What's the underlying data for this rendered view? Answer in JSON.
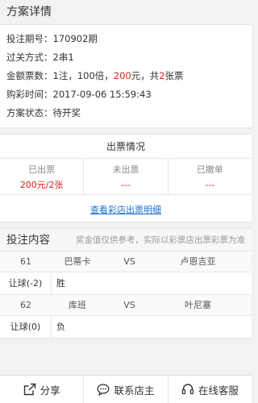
{
  "scheme": {
    "title": "方案详情",
    "rows": {
      "issue": "投注期号：170902期",
      "pass_type": "过关方式：2串1",
      "amount_prefix": "金额票数：1注，100倍，",
      "amount_money": "200",
      "amount_mid": "元，共",
      "amount_count": "2",
      "amount_suffix": "张票",
      "purchase_time": "购彩时间：2017-09-06 15:59:43",
      "status": "方案状态：待开奖"
    }
  },
  "ticket": {
    "title": "出票情况",
    "issued_label": "已出票",
    "issued_value": "200元/2张",
    "pending_label": "未出票",
    "pending_value": "---",
    "cancelled_label": "已撤单",
    "cancelled_value": "---",
    "detail_link": "查看彩店出票明细"
  },
  "bet": {
    "title": "投注内容",
    "note": "奖金值仅供参考，实际以彩票店出票彩票为准",
    "matches": [
      {
        "no": "61",
        "home": "巴蒂卡",
        "vs": "VS",
        "away": "卢恩吉亚",
        "handicap": "让球(-2)",
        "result": "胜"
      },
      {
        "no": "62",
        "home": "库班",
        "vs": "VS",
        "away": "叶尼塞",
        "handicap": "让球(0)",
        "result": "负"
      }
    ]
  },
  "bottom_bar": {
    "share": "分享",
    "contact_owner": "联系店主",
    "online_service": "在线客服"
  },
  "colors": {
    "accent_red": "#e02020",
    "link_blue": "#1a6fd1"
  },
  "icons": {
    "share": "share-icon",
    "contact": "chat-bubble-icon",
    "service": "headset-icon"
  }
}
